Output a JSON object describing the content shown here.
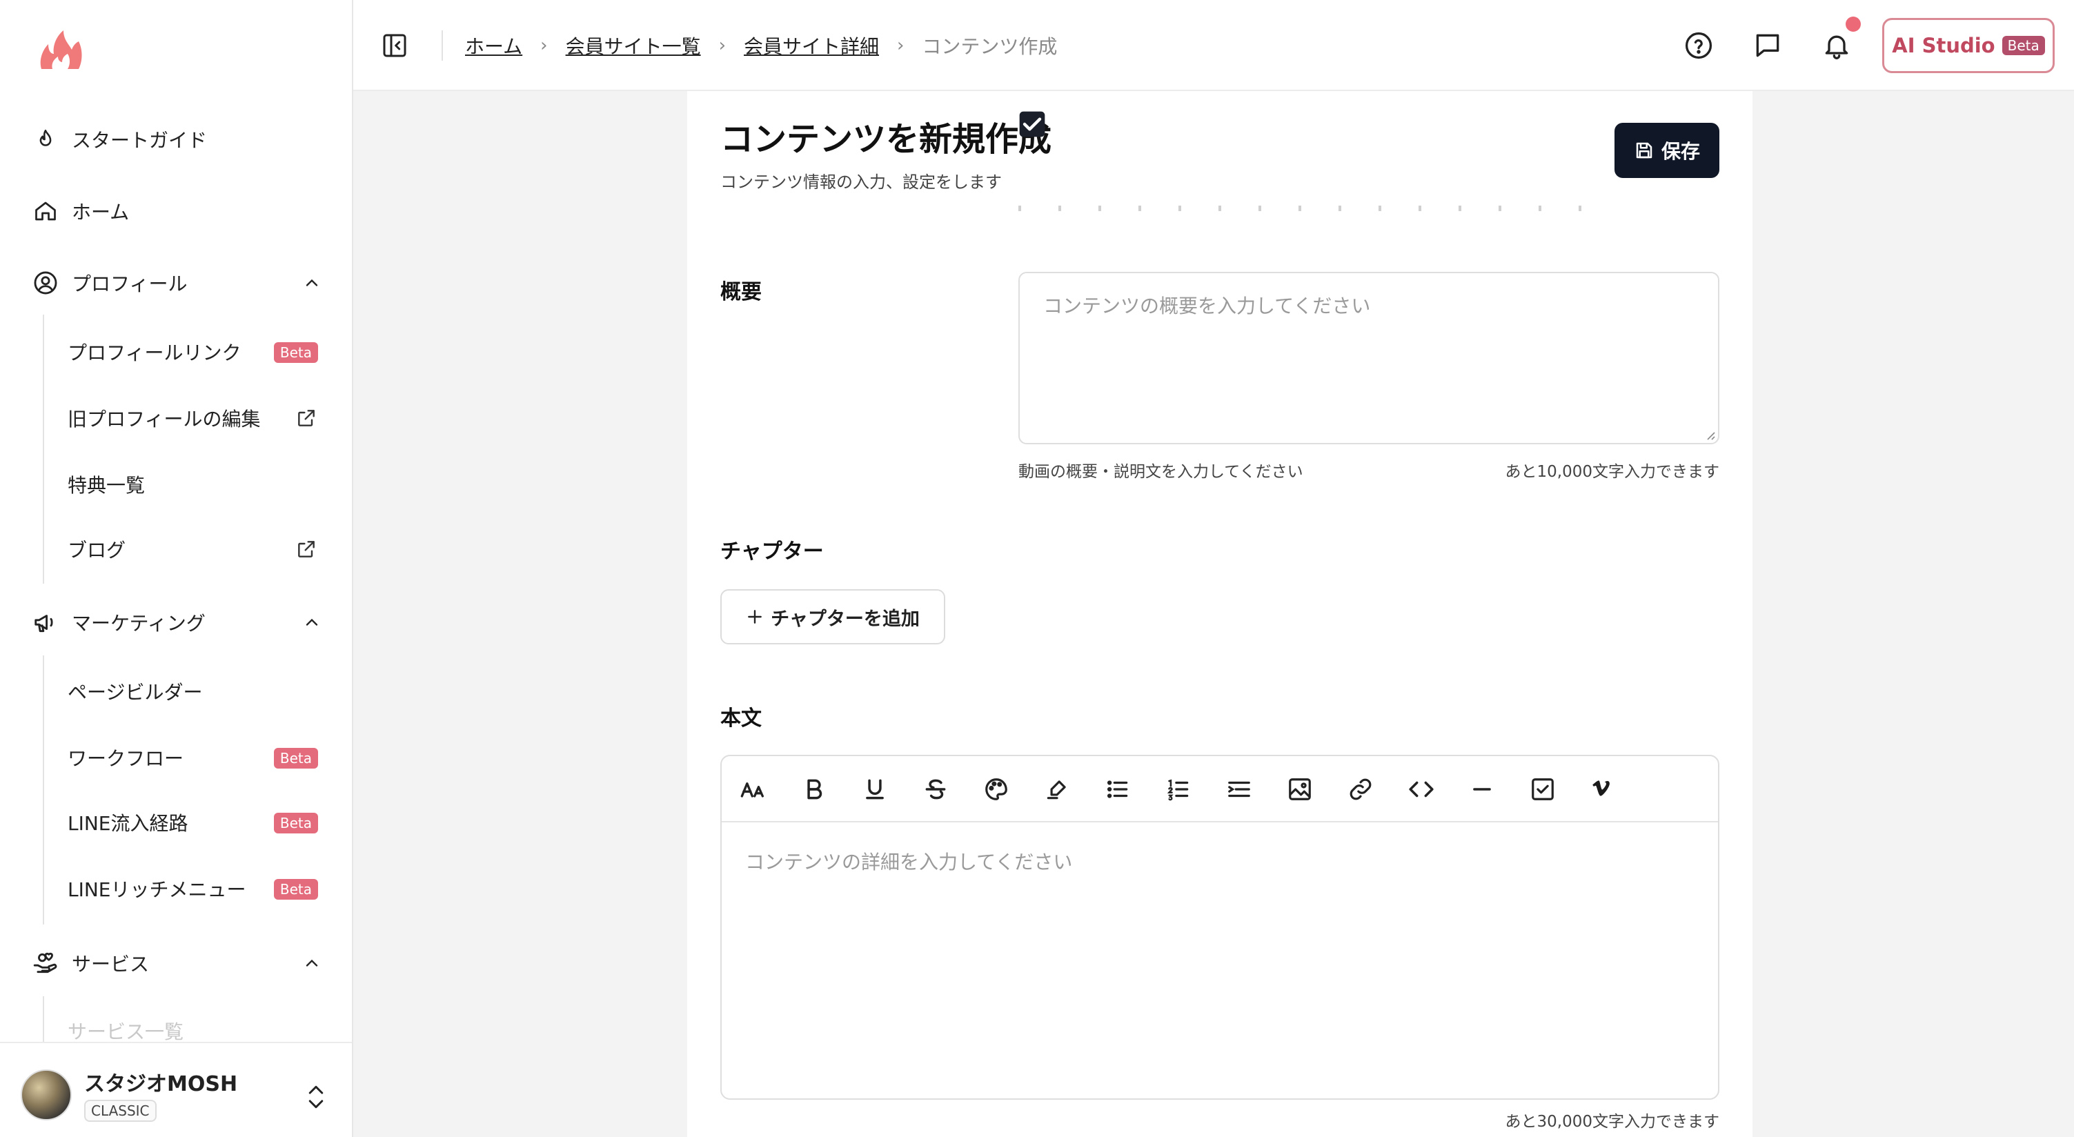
{
  "sidebar": {
    "nav": {
      "start_guide": "スタートガイド",
      "home": "ホーム",
      "profile": "プロフィール",
      "marketing": "マーケティング",
      "service": "サービス"
    },
    "profile_items": [
      {
        "label": "プロフィールリンク",
        "badge": "Beta"
      },
      {
        "label": "旧プロフィールの編集"
      },
      {
        "label": "特典一覧"
      },
      {
        "label": "ブログ"
      }
    ],
    "marketing_items": [
      {
        "label": "ページビルダー"
      },
      {
        "label": "ワークフロー",
        "badge": "Beta"
      },
      {
        "label": "LINE流入経路",
        "badge": "Beta"
      },
      {
        "label": "LINEリッチメニュー",
        "badge": "Beta"
      }
    ],
    "service_items": [
      {
        "label": "サービス一覧"
      }
    ],
    "user": {
      "name": "スタジオMOSH",
      "plan": "CLASSIC"
    }
  },
  "header": {
    "breadcrumb": [
      "ホーム",
      "会員サイト一覧",
      "会員サイト詳細",
      "コンテンツ作成"
    ],
    "ai_studio": {
      "label": "AI Studio",
      "badge": "Beta"
    }
  },
  "main": {
    "title": "コンテンツを新規作成",
    "subtitle": "コンテンツ情報の入力、設定をします",
    "save_label": "保存",
    "summary": {
      "label": "概要",
      "placeholder": "コンテンツの概要を入力してください",
      "help": "動画の概要・説明文を入力してください",
      "remaining": "あと10,000文字入力できます"
    },
    "chapter": {
      "label": "チャプター",
      "add_label": "チャプターを追加"
    },
    "body": {
      "label": "本文",
      "placeholder": "コンテンツの詳細を入力してください",
      "remaining": "あと30,000文字入力できます",
      "toolbar": [
        "font-size-icon",
        "bold-icon",
        "underline-icon",
        "strikethrough-icon",
        "palette-icon",
        "highlighter-icon",
        "bullet-list-icon",
        "numbered-list-icon",
        "indent-icon",
        "image-icon",
        "link-icon",
        "code-icon",
        "horizontal-rule-icon",
        "checkbox-icon",
        "vimeo-icon"
      ]
    }
  },
  "colors": {
    "brand": "#f07a7a",
    "beta_badge": "#e46b7c",
    "primary_button": "#101828",
    "notification": "#ec6a77"
  }
}
